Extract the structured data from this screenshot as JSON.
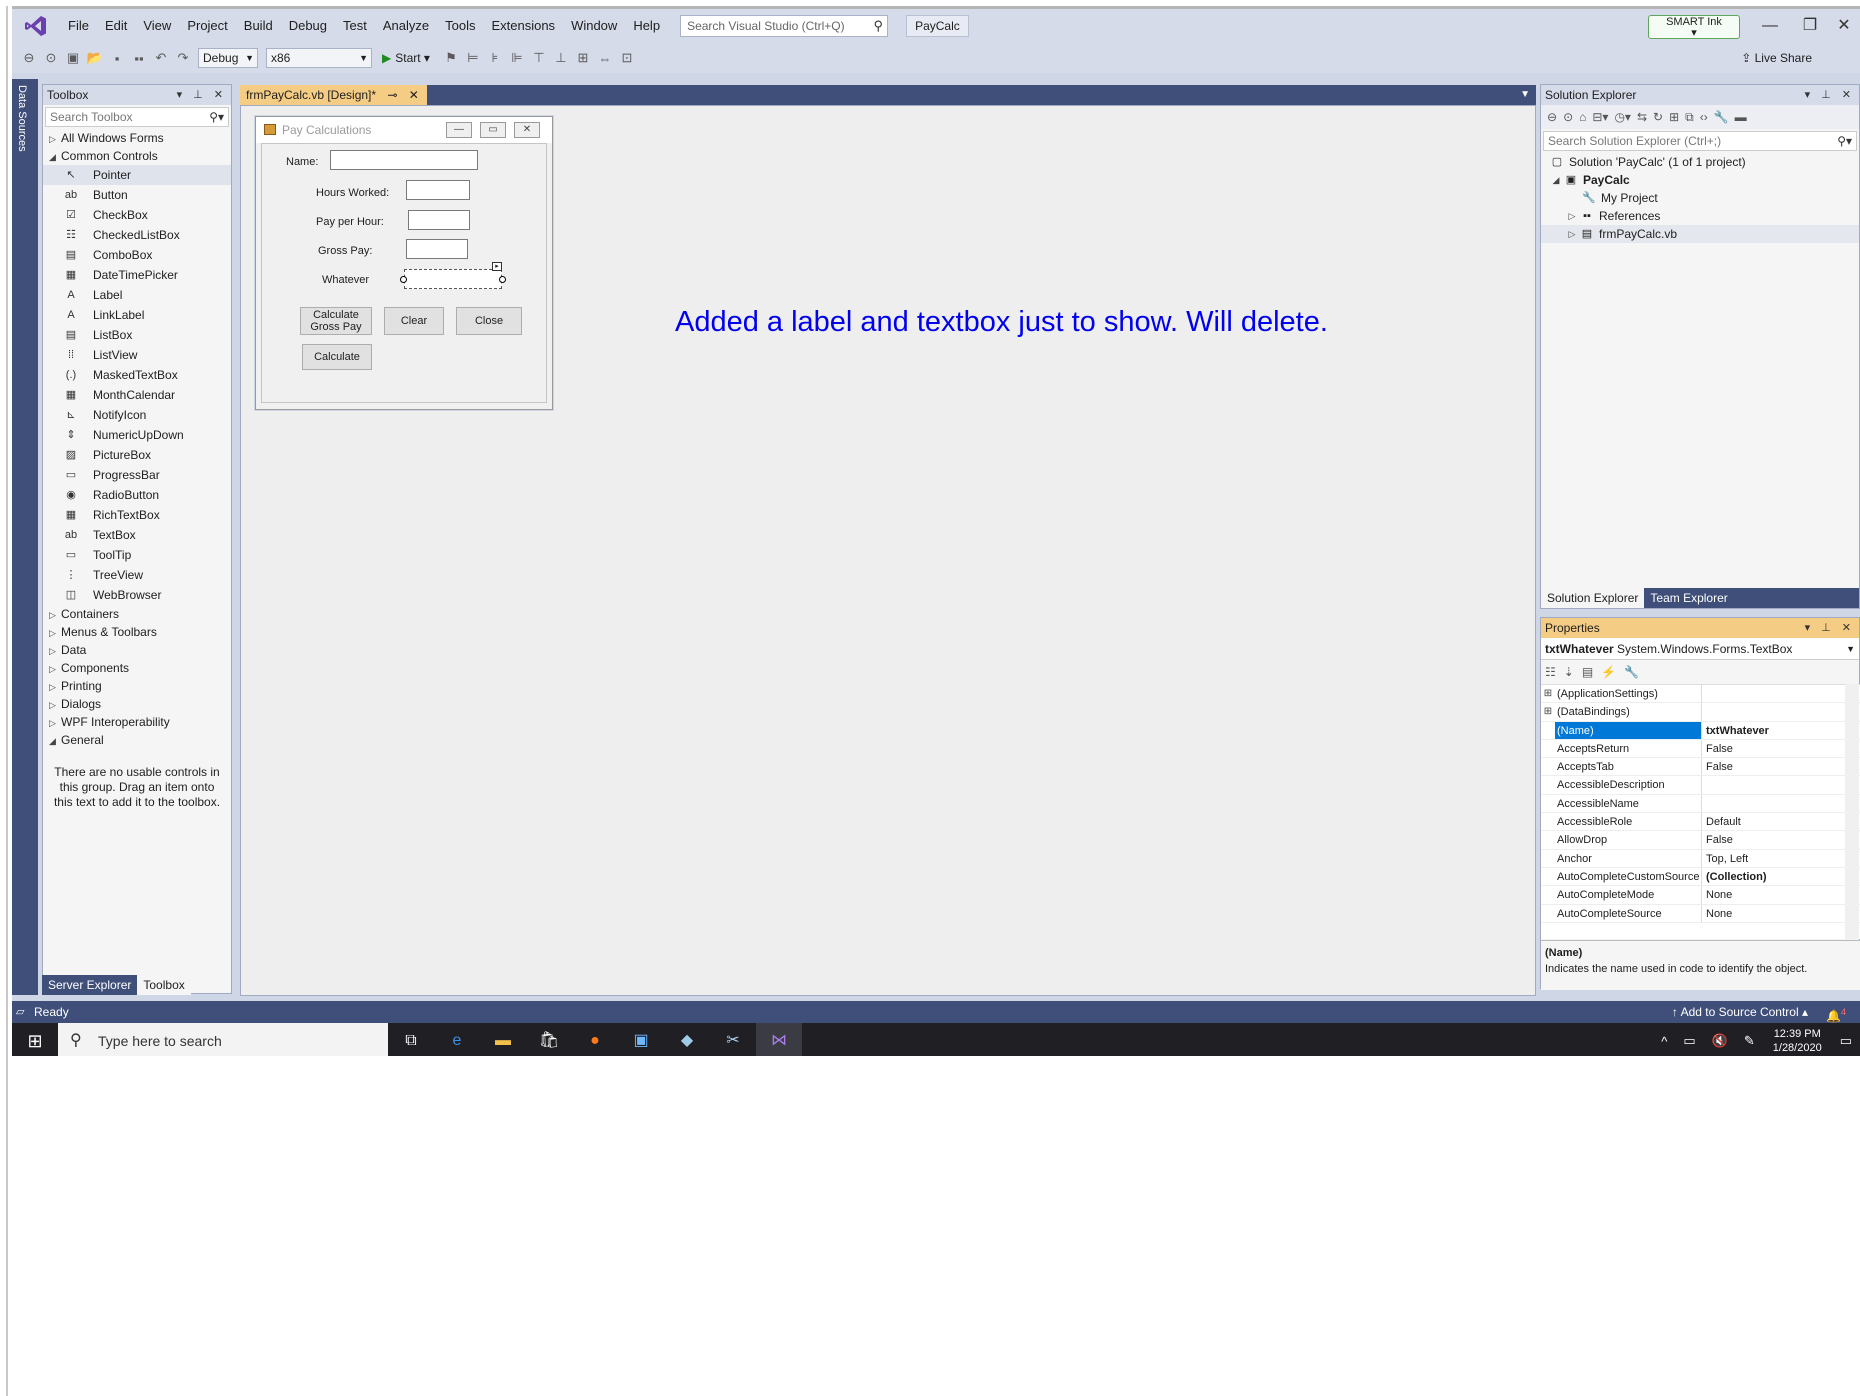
{
  "app": {
    "menu": [
      "File",
      "Edit",
      "View",
      "Project",
      "Build",
      "Debug",
      "Test",
      "Analyze",
      "Tools",
      "Extensions",
      "Window",
      "Help"
    ],
    "search_placeholder": "Search Visual Studio (Ctrl+Q)",
    "solution_name": "PayCalc",
    "smart_ink": "SMART Ink",
    "live_share": "Live Share"
  },
  "toolbar": {
    "config": "Debug",
    "platform": "x86",
    "start_label": "Start"
  },
  "data_sources_label": "Data Sources",
  "toolbox": {
    "title": "Toolbox",
    "search_placeholder": "Search Toolbox",
    "all_forms": "All Windows Forms",
    "common_controls": "Common Controls",
    "items": [
      {
        "label": "Pointer",
        "icon": "pointer-icon"
      },
      {
        "label": "Button",
        "icon": "button-icon"
      },
      {
        "label": "CheckBox",
        "icon": "checkbox-icon"
      },
      {
        "label": "CheckedListBox",
        "icon": "checkedlistbox-icon"
      },
      {
        "label": "ComboBox",
        "icon": "combobox-icon"
      },
      {
        "label": "DateTimePicker",
        "icon": "datetimepicker-icon"
      },
      {
        "label": "Label",
        "icon": "label-icon"
      },
      {
        "label": "LinkLabel",
        "icon": "linklabel-icon"
      },
      {
        "label": "ListBox",
        "icon": "listbox-icon"
      },
      {
        "label": "ListView",
        "icon": "listview-icon"
      },
      {
        "label": "MaskedTextBox",
        "icon": "maskedtextbox-icon"
      },
      {
        "label": "MonthCalendar",
        "icon": "monthcalendar-icon"
      },
      {
        "label": "NotifyIcon",
        "icon": "notifyicon-icon"
      },
      {
        "label": "NumericUpDown",
        "icon": "numericupdown-icon"
      },
      {
        "label": "PictureBox",
        "icon": "picturebox-icon"
      },
      {
        "label": "ProgressBar",
        "icon": "progressbar-icon"
      },
      {
        "label": "RadioButton",
        "icon": "radiobutton-icon"
      },
      {
        "label": "RichTextBox",
        "icon": "richtextbox-icon"
      },
      {
        "label": "TextBox",
        "icon": "textbox-icon"
      },
      {
        "label": "ToolTip",
        "icon": "tooltip-icon"
      },
      {
        "label": "TreeView",
        "icon": "treeview-icon"
      },
      {
        "label": "WebBrowser",
        "icon": "webbrowser-icon"
      }
    ],
    "groups": [
      "Containers",
      "Menus & Toolbars",
      "Data",
      "Components",
      "Printing",
      "Dialogs",
      "WPF Interoperability"
    ],
    "general": "General",
    "empty_text": "There are no usable controls in this group. Drag an item onto this text to add it to the toolbox.",
    "bottom_tabs": [
      "Server Explorer",
      "Toolbox"
    ]
  },
  "document": {
    "tab_label": "frmPayCalc.vb [Design]*"
  },
  "form": {
    "title": "Pay Calculations",
    "labels": {
      "name": "Name:",
      "hours": "Hours Worked:",
      "pay_per_hour": "Pay per Hour:",
      "gross": "Gross Pay:",
      "whatever": "Whatever"
    },
    "buttons": {
      "calc_gross": "Calculate Gross Pay",
      "clear": "Clear",
      "close": "Close",
      "calculate": "Calculate"
    }
  },
  "annotation": "Added a label and textbox just to show.  Will delete.",
  "solution_explorer": {
    "title": "Solution Explorer",
    "search_placeholder": "Search Solution Explorer (Ctrl+;)",
    "solution": "Solution 'PayCalc' (1 of 1 project)",
    "project": "PayCalc",
    "my_project": "My Project",
    "references": "References",
    "form_file": "frmPayCalc.vb",
    "tabs": [
      "Solution Explorer",
      "Team Explorer"
    ]
  },
  "properties": {
    "title": "Properties",
    "object_name": "txtWhatever",
    "object_type": "System.Windows.Forms.TextBox",
    "rows": [
      {
        "name": "(ApplicationSettings)",
        "value": "",
        "expand": "+"
      },
      {
        "name": "(DataBindings)",
        "value": "",
        "expand": "+"
      },
      {
        "name": "(Name)",
        "value": "txtWhatever",
        "expand": ""
      },
      {
        "name": "AcceptsReturn",
        "value": "False",
        "expand": ""
      },
      {
        "name": "AcceptsTab",
        "value": "False",
        "expand": ""
      },
      {
        "name": "AccessibleDescription",
        "value": "",
        "expand": ""
      },
      {
        "name": "AccessibleName",
        "value": "",
        "expand": ""
      },
      {
        "name": "AccessibleRole",
        "value": "Default",
        "expand": ""
      },
      {
        "name": "AllowDrop",
        "value": "False",
        "expand": ""
      },
      {
        "name": "Anchor",
        "value": "Top, Left",
        "expand": ""
      },
      {
        "name": "AutoCompleteCustomSource",
        "value": "(Collection)",
        "expand": ""
      },
      {
        "name": "AutoCompleteMode",
        "value": "None",
        "expand": ""
      },
      {
        "name": "AutoCompleteSource",
        "value": "None",
        "expand": ""
      }
    ],
    "desc_title": "(Name)",
    "desc_text": "Indicates the name used in code to identify the object."
  },
  "status": {
    "ready": "Ready",
    "source_control": "Add to Source Control",
    "notifications": "4"
  },
  "taskbar": {
    "search_placeholder": "Type here to search",
    "time": "12:39 PM",
    "date": "1/28/2020"
  }
}
